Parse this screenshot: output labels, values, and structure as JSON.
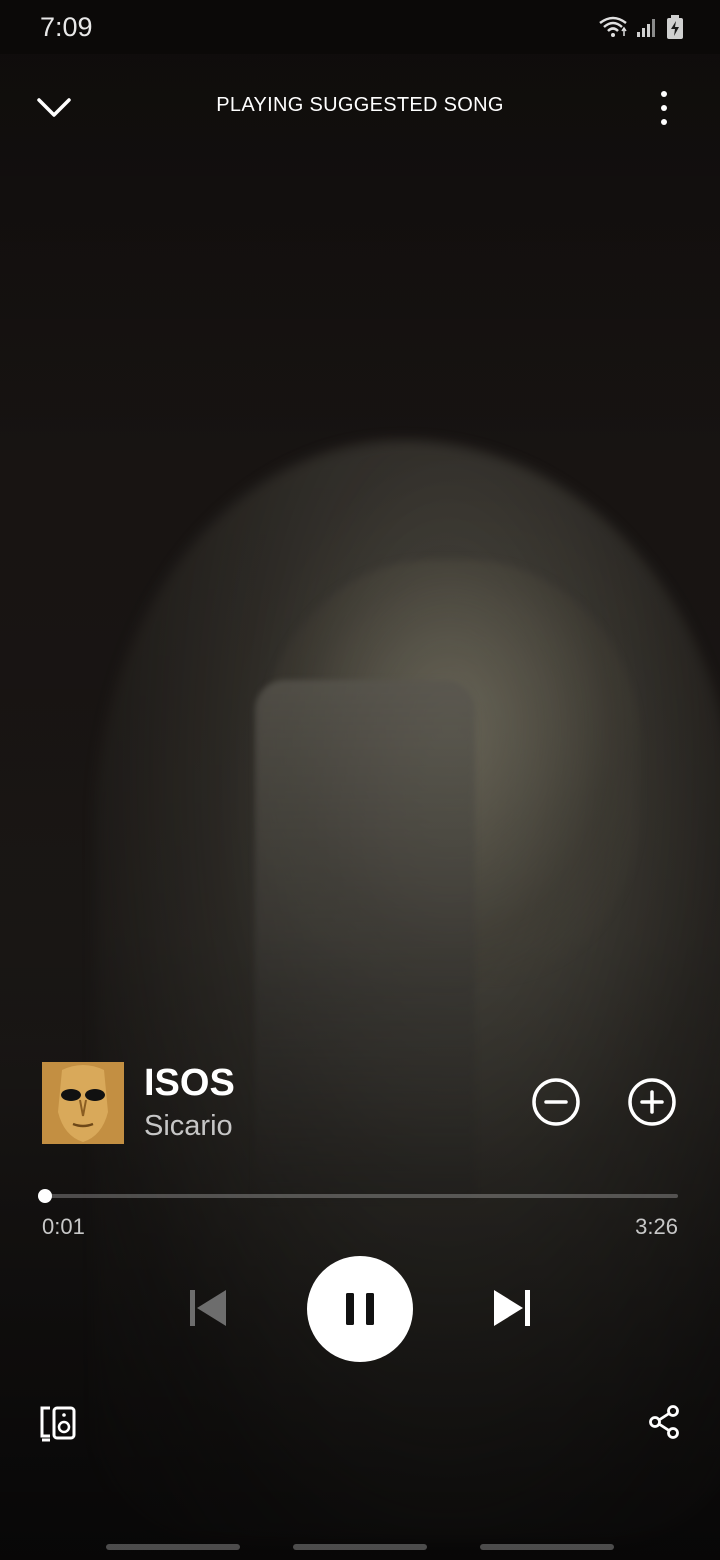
{
  "status_bar": {
    "time": "7:09",
    "icons": [
      "wifi-icon",
      "signal-icon",
      "battery-charging-icon"
    ]
  },
  "header": {
    "title": "PLAYING SUGGESTED SONG",
    "left_icon": "chevron-down-icon",
    "right_icon": "more-vertical-icon"
  },
  "track": {
    "title": "ISOS",
    "artist": "Sicario",
    "cover_icon": "album-cover"
  },
  "playback": {
    "elapsed": "0:01",
    "total": "3:26",
    "progress_fraction": 0.004,
    "state": "playing"
  },
  "controls": {
    "remove_icon": "minus-circle-icon",
    "add_icon": "plus-circle-icon",
    "prev_icon": "skip-previous-icon",
    "play_pause_icon": "pause-icon",
    "next_icon": "skip-next-icon",
    "devices_icon": "devices-icon",
    "share_icon": "share-icon"
  },
  "colors": {
    "accent": "#ffffff",
    "background": "#120f0e",
    "secondary_text": "#c6c6c6"
  }
}
